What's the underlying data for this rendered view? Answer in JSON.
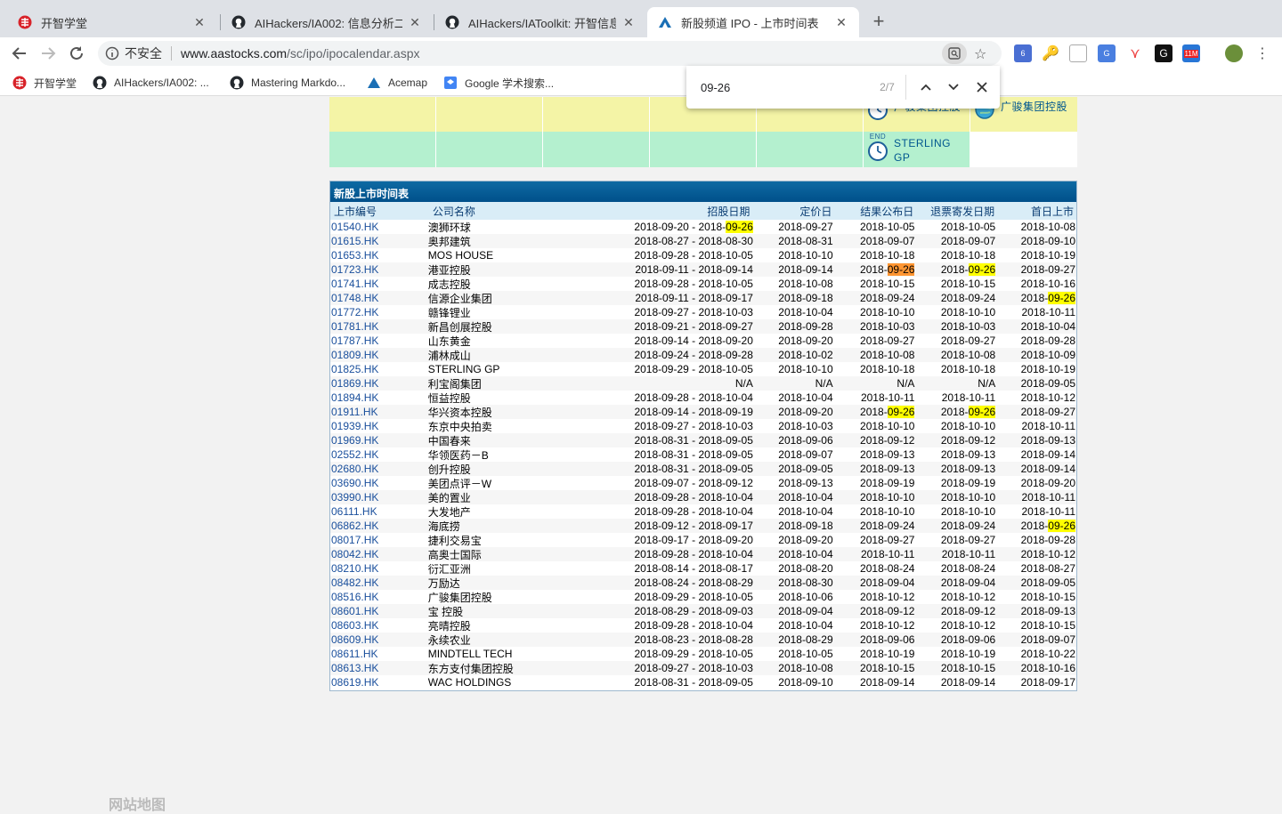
{
  "browser": {
    "tabs": [
      {
        "title": "开智学堂",
        "icon": "kaizhi-logo-icon"
      },
      {
        "title": "AIHackers/IA002: 信息分析二期",
        "icon": "github-icon"
      },
      {
        "title": "AIHackers/IAToolkit: 开智信息分",
        "icon": "github-icon"
      },
      {
        "title": "新股频道 IPO - 上市时间表",
        "icon": "aastocks-icon",
        "active": true
      }
    ],
    "security_label": "不安全",
    "url_host": "www.aastocks.com",
    "url_path": "/sc/ipo/ipocalendar.aspx",
    "extension_badges": {
      "reader": "6",
      "mail": "11M"
    },
    "bookmarks": [
      {
        "label": "开智学堂",
        "icon": "kaizhi-logo-icon"
      },
      {
        "label": "AIHackers/IA002: ...",
        "icon": "github-icon"
      },
      {
        "label": "Mastering Markdo...",
        "icon": "github-icon"
      },
      {
        "label": "Acemap",
        "icon": "acemap-icon"
      },
      {
        "label": "Google 学术搜索...",
        "icon": "google-scholar-icon"
      }
    ]
  },
  "find": {
    "query": "09-26",
    "count": "2/7"
  },
  "calendar": {
    "top_event": "广骏集团控股",
    "top_event_partial": "广骏集团控股",
    "end_badge": "END",
    "end_event": "STERLING GP",
    "colors": {
      "yellow": "#f4f4a6",
      "green": "#b4f0cf"
    }
  },
  "table": {
    "title": "新股上市时间表",
    "headers": {
      "code": "上市编号",
      "name": "公司名称",
      "subscription": "招股日期",
      "pricing": "定价日",
      "result": "结果公布日",
      "refund": "退票寄发日期",
      "first_day": "首日上市"
    },
    "rows": [
      [
        "01540.HK",
        "澳狮环球",
        "2018-09-20 - 2018-09-26",
        "2018-09-27",
        "2018-10-05",
        "2018-10-05",
        "2018-10-08"
      ],
      [
        "01615.HK",
        "奥邦建筑",
        "2018-08-27 - 2018-08-30",
        "2018-08-31",
        "2018-09-07",
        "2018-09-07",
        "2018-09-10"
      ],
      [
        "01653.HK",
        "MOS HOUSE",
        "2018-09-28 - 2018-10-05",
        "2018-10-10",
        "2018-10-18",
        "2018-10-18",
        "2018-10-19"
      ],
      [
        "01723.HK",
        "港亚控股",
        "2018-09-11 - 2018-09-14",
        "2018-09-14",
        "2018-09-26",
        "2018-09-26",
        "2018-09-27"
      ],
      [
        "01741.HK",
        "成志控股",
        "2018-09-28 - 2018-10-05",
        "2018-10-08",
        "2018-10-15",
        "2018-10-15",
        "2018-10-16"
      ],
      [
        "01748.HK",
        "信源企业集团",
        "2018-09-11 - 2018-09-17",
        "2018-09-18",
        "2018-09-24",
        "2018-09-24",
        "2018-09-26"
      ],
      [
        "01772.HK",
        "赣锋锂业",
        "2018-09-27 - 2018-10-03",
        "2018-10-04",
        "2018-10-10",
        "2018-10-10",
        "2018-10-11"
      ],
      [
        "01781.HK",
        "新昌创展控股",
        "2018-09-21 - 2018-09-27",
        "2018-09-28",
        "2018-10-03",
        "2018-10-03",
        "2018-10-04"
      ],
      [
        "01787.HK",
        "山东黄金",
        "2018-09-14 - 2018-09-20",
        "2018-09-20",
        "2018-09-27",
        "2018-09-27",
        "2018-09-28"
      ],
      [
        "01809.HK",
        "浦林成山",
        "2018-09-24 - 2018-09-28",
        "2018-10-02",
        "2018-10-08",
        "2018-10-08",
        "2018-10-09"
      ],
      [
        "01825.HK",
        "STERLING GP",
        "2018-09-29 - 2018-10-05",
        "2018-10-10",
        "2018-10-18",
        "2018-10-18",
        "2018-10-19"
      ],
      [
        "01869.HK",
        "利宝阁集团",
        "N/A",
        "N/A",
        "N/A",
        "N/A",
        "2018-09-05"
      ],
      [
        "01894.HK",
        "恒益控股",
        "2018-09-28 - 2018-10-04",
        "2018-10-04",
        "2018-10-11",
        "2018-10-11",
        "2018-10-12"
      ],
      [
        "01911.HK",
        "华兴资本控股",
        "2018-09-14 - 2018-09-19",
        "2018-09-20",
        "2018-09-26",
        "2018-09-26",
        "2018-09-27"
      ],
      [
        "01939.HK",
        "东京中央拍卖",
        "2018-09-27 - 2018-10-03",
        "2018-10-03",
        "2018-10-10",
        "2018-10-10",
        "2018-10-11"
      ],
      [
        "01969.HK",
        "中国春来",
        "2018-08-31 - 2018-09-05",
        "2018-09-06",
        "2018-09-12",
        "2018-09-12",
        "2018-09-13"
      ],
      [
        "02552.HK",
        "华领医药－B",
        "2018-08-31 - 2018-09-05",
        "2018-09-07",
        "2018-09-13",
        "2018-09-13",
        "2018-09-14"
      ],
      [
        "02680.HK",
        "创升控股",
        "2018-08-31 - 2018-09-05",
        "2018-09-05",
        "2018-09-13",
        "2018-09-13",
        "2018-09-14"
      ],
      [
        "03690.HK",
        "美团点评－W",
        "2018-09-07 - 2018-09-12",
        "2018-09-13",
        "2018-09-19",
        "2018-09-19",
        "2018-09-20"
      ],
      [
        "03990.HK",
        "美的置业",
        "2018-09-28 - 2018-10-04",
        "2018-10-04",
        "2018-10-10",
        "2018-10-10",
        "2018-10-11"
      ],
      [
        "06111.HK",
        "大发地产",
        "2018-09-28 - 2018-10-04",
        "2018-10-04",
        "2018-10-10",
        "2018-10-10",
        "2018-10-11"
      ],
      [
        "06862.HK",
        "海底捞",
        "2018-09-12 - 2018-09-17",
        "2018-09-18",
        "2018-09-24",
        "2018-09-24",
        "2018-09-26"
      ],
      [
        "08017.HK",
        "捷利交易宝",
        "2018-09-17 - 2018-09-20",
        "2018-09-20",
        "2018-09-27",
        "2018-09-27",
        "2018-09-28"
      ],
      [
        "08042.HK",
        "高奥士国际",
        "2018-09-28 - 2018-10-04",
        "2018-10-04",
        "2018-10-11",
        "2018-10-11",
        "2018-10-12"
      ],
      [
        "08210.HK",
        "衍汇亚洲",
        "2018-08-14 - 2018-08-17",
        "2018-08-20",
        "2018-08-24",
        "2018-08-24",
        "2018-08-27"
      ],
      [
        "08482.HK",
        "万励达",
        "2018-08-24 - 2018-08-29",
        "2018-08-30",
        "2018-09-04",
        "2018-09-04",
        "2018-09-05"
      ],
      [
        "08516.HK",
        "广骏集团控股",
        "2018-09-29 - 2018-10-05",
        "2018-10-06",
        "2018-10-12",
        "2018-10-12",
        "2018-10-15"
      ],
      [
        "08601.HK",
        "宝 控股",
        "2018-08-29 - 2018-09-03",
        "2018-09-04",
        "2018-09-12",
        "2018-09-12",
        "2018-09-13"
      ],
      [
        "08603.HK",
        "亮晴控股",
        "2018-09-28 - 2018-10-04",
        "2018-10-04",
        "2018-10-12",
        "2018-10-12",
        "2018-10-15"
      ],
      [
        "08609.HK",
        "永续农业",
        "2018-08-23 - 2018-08-28",
        "2018-08-29",
        "2018-09-06",
        "2018-09-06",
        "2018-09-07"
      ],
      [
        "08611.HK",
        "MINDTELL TECH",
        "2018-09-29 - 2018-10-05",
        "2018-10-05",
        "2018-10-19",
        "2018-10-19",
        "2018-10-22"
      ],
      [
        "08613.HK",
        "东方支付集团控股",
        "2018-09-27 - 2018-10-03",
        "2018-10-08",
        "2018-10-15",
        "2018-10-15",
        "2018-10-16"
      ],
      [
        "08619.HK",
        "WAC HOLDINGS",
        "2018-08-31 - 2018-09-05",
        "2018-09-10",
        "2018-09-14",
        "2018-09-14",
        "2018-09-17"
      ]
    ]
  },
  "footer": {
    "site_map": "网站地图"
  }
}
